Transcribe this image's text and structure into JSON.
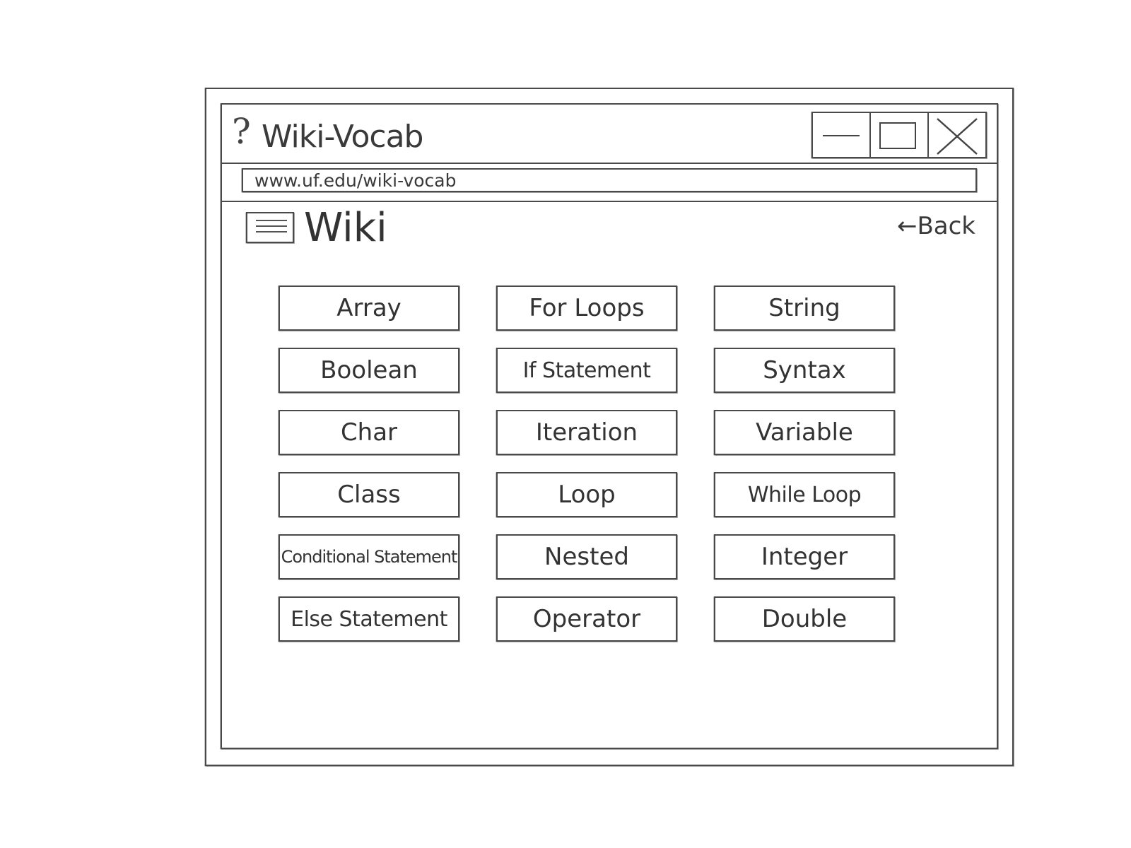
{
  "window": {
    "title": "Wiki-Vocab",
    "help_icon": "question-mark-icon",
    "controls": [
      "minimize-icon",
      "maximize-icon",
      "close-icon"
    ]
  },
  "address_bar": {
    "url": "www.uf.edu/wiki-vocab"
  },
  "header": {
    "menu_icon": "hamburger-menu-icon",
    "title": "Wiki",
    "back_label": "←Back"
  },
  "vocab_terms": [
    "Array",
    "For Loops",
    "String",
    "Boolean",
    "If Statement",
    "Syntax",
    "Char",
    "Iteration",
    "Variable",
    "Class",
    "Loop",
    "While Loop",
    "Conditional Statement",
    "Nested",
    "Integer",
    "Else Statement",
    "Operator",
    "Double"
  ],
  "colors": {
    "stroke": "#4a4a4a",
    "text": "#3a3a3a",
    "background": "#ffffff"
  }
}
